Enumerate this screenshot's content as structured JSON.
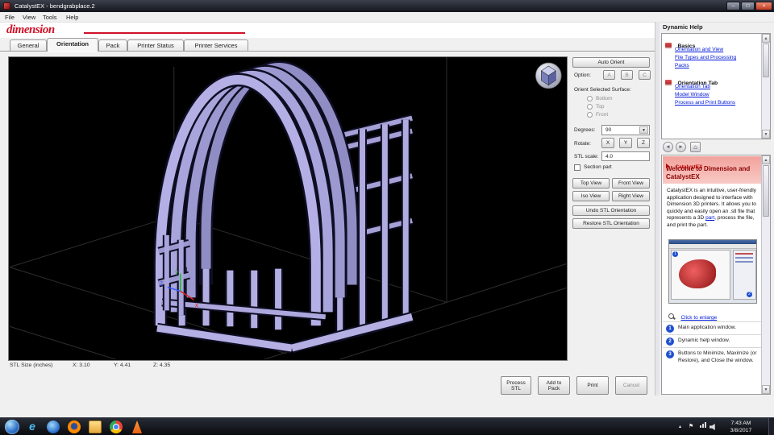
{
  "icons": {
    "minimize": "–",
    "maximize": "□",
    "close": "×",
    "back": "◄",
    "forward": "►",
    "home": "⌂",
    "scroll_up": "▲",
    "scroll_down": "▼",
    "dropdown": "▼",
    "ie": "e",
    "up_chevron": "▴",
    "flag": "⚑"
  },
  "window": {
    "title": "CatalystEX - bendgrabplace.2",
    "menus": [
      "File",
      "View",
      "Tools",
      "Help"
    ]
  },
  "logo": "dimension",
  "tabs": [
    "General",
    "Orientation",
    "Pack",
    "Printer Status",
    "Printer Services"
  ],
  "viewport": {
    "axis_x": "X",
    "axis_y": "Y",
    "axis_z": "Z"
  },
  "controls": {
    "auto_orient": "Auto Orient",
    "option_label": "Option:",
    "option_a": "A",
    "option_b": "B",
    "option_c": "C",
    "surface_label": "Orient Selected Surface:",
    "surface_bottom": "Bottom",
    "surface_top": "Top",
    "surface_front": "Front",
    "degrees_label": "Degrees:",
    "degrees_value": "90",
    "rotate_label": "Rotate:",
    "axis_x": "X",
    "axis_y": "Y",
    "axis_z": "Z",
    "scale_label": "STL scale:",
    "scale_value": "4.0",
    "section_label": "Section part",
    "view_top": "Top View",
    "view_front": "Front View",
    "view_iso": "Iso View",
    "view_right": "Right View",
    "undo": "Undo STL Orientation",
    "restore": "Restore STL Orientation"
  },
  "help": {
    "title": "Dynamic Help",
    "basics_heading": "Basics",
    "basics_links": [
      "Orientation and View",
      "File Types and Processing",
      "Packs"
    ],
    "orientation_heading": "Orientation Tab",
    "orientation_links": [
      "Orientation Tab",
      "Model Window",
      "Process and Print Buttons"
    ],
    "welcome_brand": "CatalystEX",
    "welcome_heading": "Welcome to Dimension and CatalystEX",
    "body_text_1": "CatalystEX is an intuitive, user-friendly application designed to interface with Dimension 3D printers. It allows you to quickly and easily open an .stl file that represents a 3D ",
    "body_link": "part",
    "body_text_2": ", process the file, and print the part.",
    "enlarge_link": "Click to enlarge",
    "steps": [
      {
        "num": "1",
        "text": "Main application window."
      },
      {
        "num": "2",
        "text": "Dynamic help window."
      },
      {
        "num": "3",
        "text": "Buttons to Minimize, Maximize (or Restore), and Close the window."
      }
    ]
  },
  "status": {
    "label": "STL Size (inches)",
    "x": "X: 3.10",
    "y": "Y: 4.41",
    "z": "Z: 4.35"
  },
  "actions": {
    "process_1": "Process",
    "process_2": "STL",
    "add_1": "Add to",
    "add_2": "Pack",
    "print": "Print",
    "cancel": "Cancel"
  },
  "taskbar": {
    "time": "7:43 AM",
    "date": "3/8/2017"
  }
}
